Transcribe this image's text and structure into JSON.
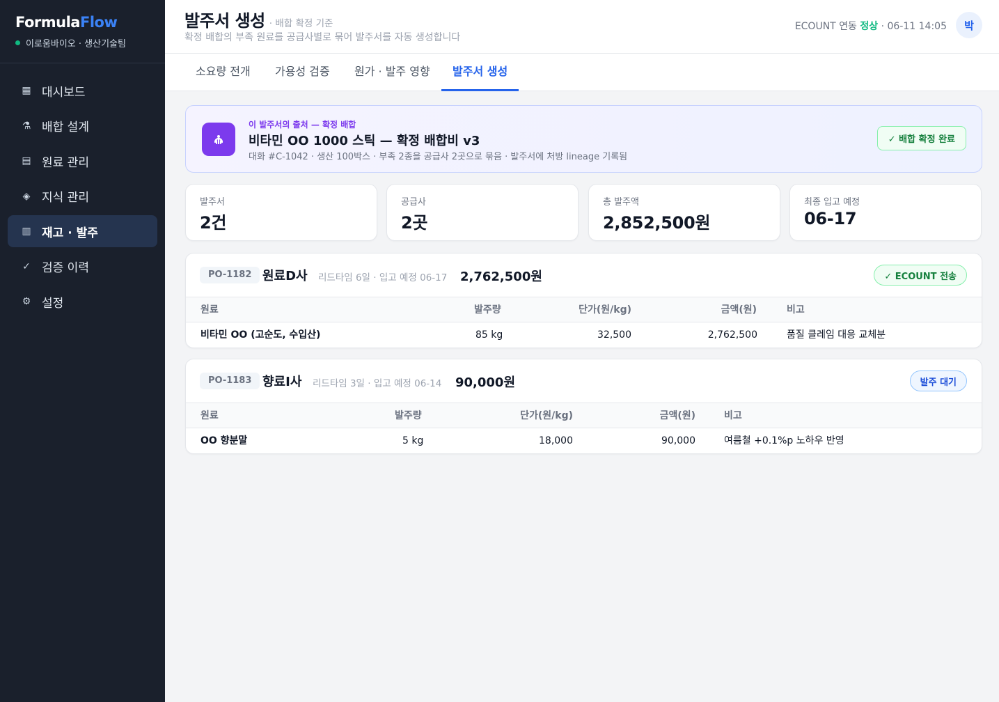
{
  "brand": {
    "name_a": "Formula",
    "name_b": "Flow",
    "org": "이로움바이오 · 생산기술팀"
  },
  "nav": [
    {
      "icon": "grid-icon",
      "glyph": "▦",
      "label": "대시보드"
    },
    {
      "icon": "flask-icon",
      "glyph": "⚗",
      "label": "배합 설계"
    },
    {
      "icon": "list-icon",
      "glyph": "▤",
      "label": "원료 관리"
    },
    {
      "icon": "diamond-icon",
      "glyph": "◈",
      "label": "지식 관리"
    },
    {
      "icon": "barcode-icon",
      "glyph": "▥",
      "label": "재고 · 발주"
    },
    {
      "icon": "check-icon",
      "glyph": "✓",
      "label": "검증 이력"
    },
    {
      "icon": "gear-icon",
      "glyph": "⚙",
      "label": "설정"
    }
  ],
  "header": {
    "title": "발주서 생성",
    "subtitle": "· 배합 확정 기준",
    "description": "확정 배합의 부족 원료를 공급사별로 묶어 발주서를 자동 생성합니다",
    "sync_prefix": "ECOUNT 연동",
    "sync_status": "정상",
    "sync_time": "· 06-11 14:05",
    "avatar": "박"
  },
  "tabs": [
    "소요량 전개",
    "가용성 검증",
    "원가 · 발주 영향",
    "발주서 생성"
  ],
  "origin": {
    "kicker": "이 발주서의 출처 — 확정 배합",
    "title": "비타민 OO 1000 스틱 — 확정 배합비 v3",
    "detail": "대화 #C-1042 · 생산 100박스 · 부족 2종을 공급사 2곳으로 묶음 · 발주서에 처방 lineage 기록됨",
    "badge": "✓ 배합 확정 완료"
  },
  "stats": [
    {
      "label": "발주서",
      "value": "2건"
    },
    {
      "label": "공급사",
      "value": "2곳"
    },
    {
      "label": "총 발주액",
      "value": "2,852,500원"
    },
    {
      "label": "최종 입고 예정",
      "value": "06-17"
    }
  ],
  "purchase_orders": [
    {
      "id": "PO-1182",
      "supplier": "원료D사",
      "lead": "리드타임 6일 · 입고 예정 06-17",
      "total": "2,762,500원",
      "status": "✓ ECOUNT 전송",
      "columns": [
        "원료",
        "발주량",
        "단가(원/kg)",
        "금액(원)",
        "비고"
      ],
      "rows": [
        {
          "material": "비타민 OO (고순도, 수입산)",
          "qty": "85 kg",
          "unit_price": "32,500",
          "amount": "2,762,500",
          "note": "품질 클레임 대응 교체분"
        }
      ]
    },
    {
      "id": "PO-1183",
      "supplier": "향료I사",
      "lead": "리드타임 3일 · 입고 예정 06-14",
      "total": "90,000원",
      "status": "발주 대기",
      "columns": [
        "원료",
        "발주량",
        "단가(원/kg)",
        "금액(원)",
        "비고"
      ],
      "rows": [
        {
          "material": "OO 향분말",
          "qty": "5 kg",
          "unit_price": "18,000",
          "amount": "90,000",
          "note": "여름철 +0.1%p 노하우 반영"
        }
      ]
    }
  ]
}
